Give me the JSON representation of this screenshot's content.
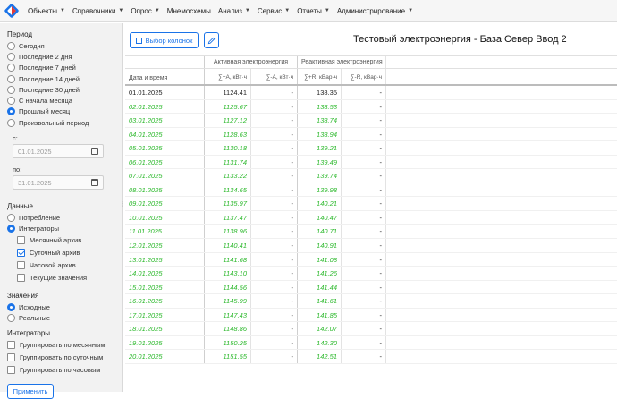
{
  "navbar": {
    "items": [
      {
        "label": "Объекты",
        "caret": true
      },
      {
        "label": "Справочники",
        "caret": true
      },
      {
        "label": "Опрос",
        "caret": true
      },
      {
        "label": "Мнемосхемы",
        "caret": false
      },
      {
        "label": "Анализ",
        "caret": true
      },
      {
        "label": "Сервис",
        "caret": true
      },
      {
        "label": "Отчеты",
        "caret": true
      },
      {
        "label": "Администрирование",
        "caret": true
      }
    ]
  },
  "sidebar": {
    "period_title": "Период",
    "period_options": [
      {
        "label": "Сегодня",
        "selected": false
      },
      {
        "label": "Последние 2 дня",
        "selected": false
      },
      {
        "label": "Последние 7 дней",
        "selected": false
      },
      {
        "label": "Последние 14 дней",
        "selected": false
      },
      {
        "label": "Последние 30 дней",
        "selected": false
      },
      {
        "label": "С начала месяца",
        "selected": false
      },
      {
        "label": "Прошлый месяц",
        "selected": true
      },
      {
        "label": "Произвольный период",
        "selected": false
      }
    ],
    "from_label": "с:",
    "from_value": "01.01.2025",
    "to_label": "по:",
    "to_value": "31.01.2025",
    "data_title": "Данные",
    "data_options": [
      {
        "label": "Потребление",
        "selected": false
      },
      {
        "label": "Интеграторы",
        "selected": true
      }
    ],
    "archives": [
      {
        "label": "Месячный архив",
        "checked": false
      },
      {
        "label": "Суточный архив",
        "checked": true
      },
      {
        "label": "Часовой архив",
        "checked": false
      },
      {
        "label": "Текущие значения",
        "checked": false
      }
    ],
    "values_title": "Значения",
    "values_options": [
      {
        "label": "Исходные",
        "selected": true
      },
      {
        "label": "Реальные",
        "selected": false
      }
    ],
    "integrators_title": "Интеграторы",
    "grouping": [
      {
        "label": "Группировать по месячным",
        "checked": false
      },
      {
        "label": "Группировать по суточным",
        "checked": false
      },
      {
        "label": "Группировать по часовым",
        "checked": false
      }
    ],
    "apply_label": "Применить"
  },
  "main": {
    "columns_button": "Выбор колонок",
    "title": "Тестовый электроэнергия - База Север Ввод 2"
  },
  "table": {
    "group_active": "Активная электроэнергия",
    "group_reactive": "Реактивная электроэнергия",
    "col_date": "Дата и время",
    "col_a_plus": "∑+A, кВт·ч",
    "col_a_minus": "∑-A, кВт·ч",
    "col_r_plus": "∑+R, кВар·ч",
    "col_r_minus": "∑-R, кВар·ч",
    "rows": [
      {
        "date": "01.01.2025",
        "a_plus": "1124.41",
        "a_minus": "-",
        "r_plus": "138.35",
        "r_minus": "-",
        "computed": false
      },
      {
        "date": "02.01.2025",
        "a_plus": "1125.67",
        "a_minus": "-",
        "r_plus": "138.53",
        "r_minus": "-",
        "computed": true
      },
      {
        "date": "03.01.2025",
        "a_plus": "1127.12",
        "a_minus": "-",
        "r_plus": "138.74",
        "r_minus": "-",
        "computed": true
      },
      {
        "date": "04.01.2025",
        "a_plus": "1128.63",
        "a_minus": "-",
        "r_plus": "138.94",
        "r_minus": "-",
        "computed": true
      },
      {
        "date": "05.01.2025",
        "a_plus": "1130.18",
        "a_minus": "-",
        "r_plus": "139.21",
        "r_minus": "-",
        "computed": true
      },
      {
        "date": "06.01.2025",
        "a_plus": "1131.74",
        "a_minus": "-",
        "r_plus": "139.49",
        "r_minus": "-",
        "computed": true
      },
      {
        "date": "07.01.2025",
        "a_plus": "1133.22",
        "a_minus": "-",
        "r_plus": "139.74",
        "r_minus": "-",
        "computed": true
      },
      {
        "date": "08.01.2025",
        "a_plus": "1134.65",
        "a_minus": "-",
        "r_plus": "139.98",
        "r_minus": "-",
        "computed": true
      },
      {
        "date": "09.01.2025",
        "a_plus": "1135.97",
        "a_minus": "-",
        "r_plus": "140.21",
        "r_minus": "-",
        "computed": true
      },
      {
        "date": "10.01.2025",
        "a_plus": "1137.47",
        "a_minus": "-",
        "r_plus": "140.47",
        "r_minus": "-",
        "computed": true
      },
      {
        "date": "11.01.2025",
        "a_plus": "1138.96",
        "a_minus": "-",
        "r_plus": "140.71",
        "r_minus": "-",
        "computed": true
      },
      {
        "date": "12.01.2025",
        "a_plus": "1140.41",
        "a_minus": "-",
        "r_plus": "140.91",
        "r_minus": "-",
        "computed": true
      },
      {
        "date": "13.01.2025",
        "a_plus": "1141.68",
        "a_minus": "-",
        "r_plus": "141.08",
        "r_minus": "-",
        "computed": true
      },
      {
        "date": "14.01.2025",
        "a_plus": "1143.10",
        "a_minus": "-",
        "r_plus": "141.26",
        "r_minus": "-",
        "computed": true
      },
      {
        "date": "15.01.2025",
        "a_plus": "1144.56",
        "a_minus": "-",
        "r_plus": "141.44",
        "r_minus": "-",
        "computed": true
      },
      {
        "date": "16.01.2025",
        "a_plus": "1145.99",
        "a_minus": "-",
        "r_plus": "141.61",
        "r_minus": "-",
        "computed": true
      },
      {
        "date": "17.01.2025",
        "a_plus": "1147.43",
        "a_minus": "-",
        "r_plus": "141.85",
        "r_minus": "-",
        "computed": true
      },
      {
        "date": "18.01.2025",
        "a_plus": "1148.86",
        "a_minus": "-",
        "r_plus": "142.07",
        "r_minus": "-",
        "computed": true
      },
      {
        "date": "19.01.2025",
        "a_plus": "1150.25",
        "a_minus": "-",
        "r_plus": "142.30",
        "r_minus": "-",
        "computed": true
      },
      {
        "date": "20.01.2025",
        "a_plus": "1151.55",
        "a_minus": "-",
        "r_plus": "142.51",
        "r_minus": "-",
        "computed": true
      }
    ]
  },
  "colors": {
    "accent": "#1a73e8",
    "computed_value": "#2bb82b"
  },
  "icons": {
    "logo": "logo-icon",
    "calendar": "calendar-icon",
    "edit": "pencil-icon",
    "columns": "columns-icon"
  }
}
